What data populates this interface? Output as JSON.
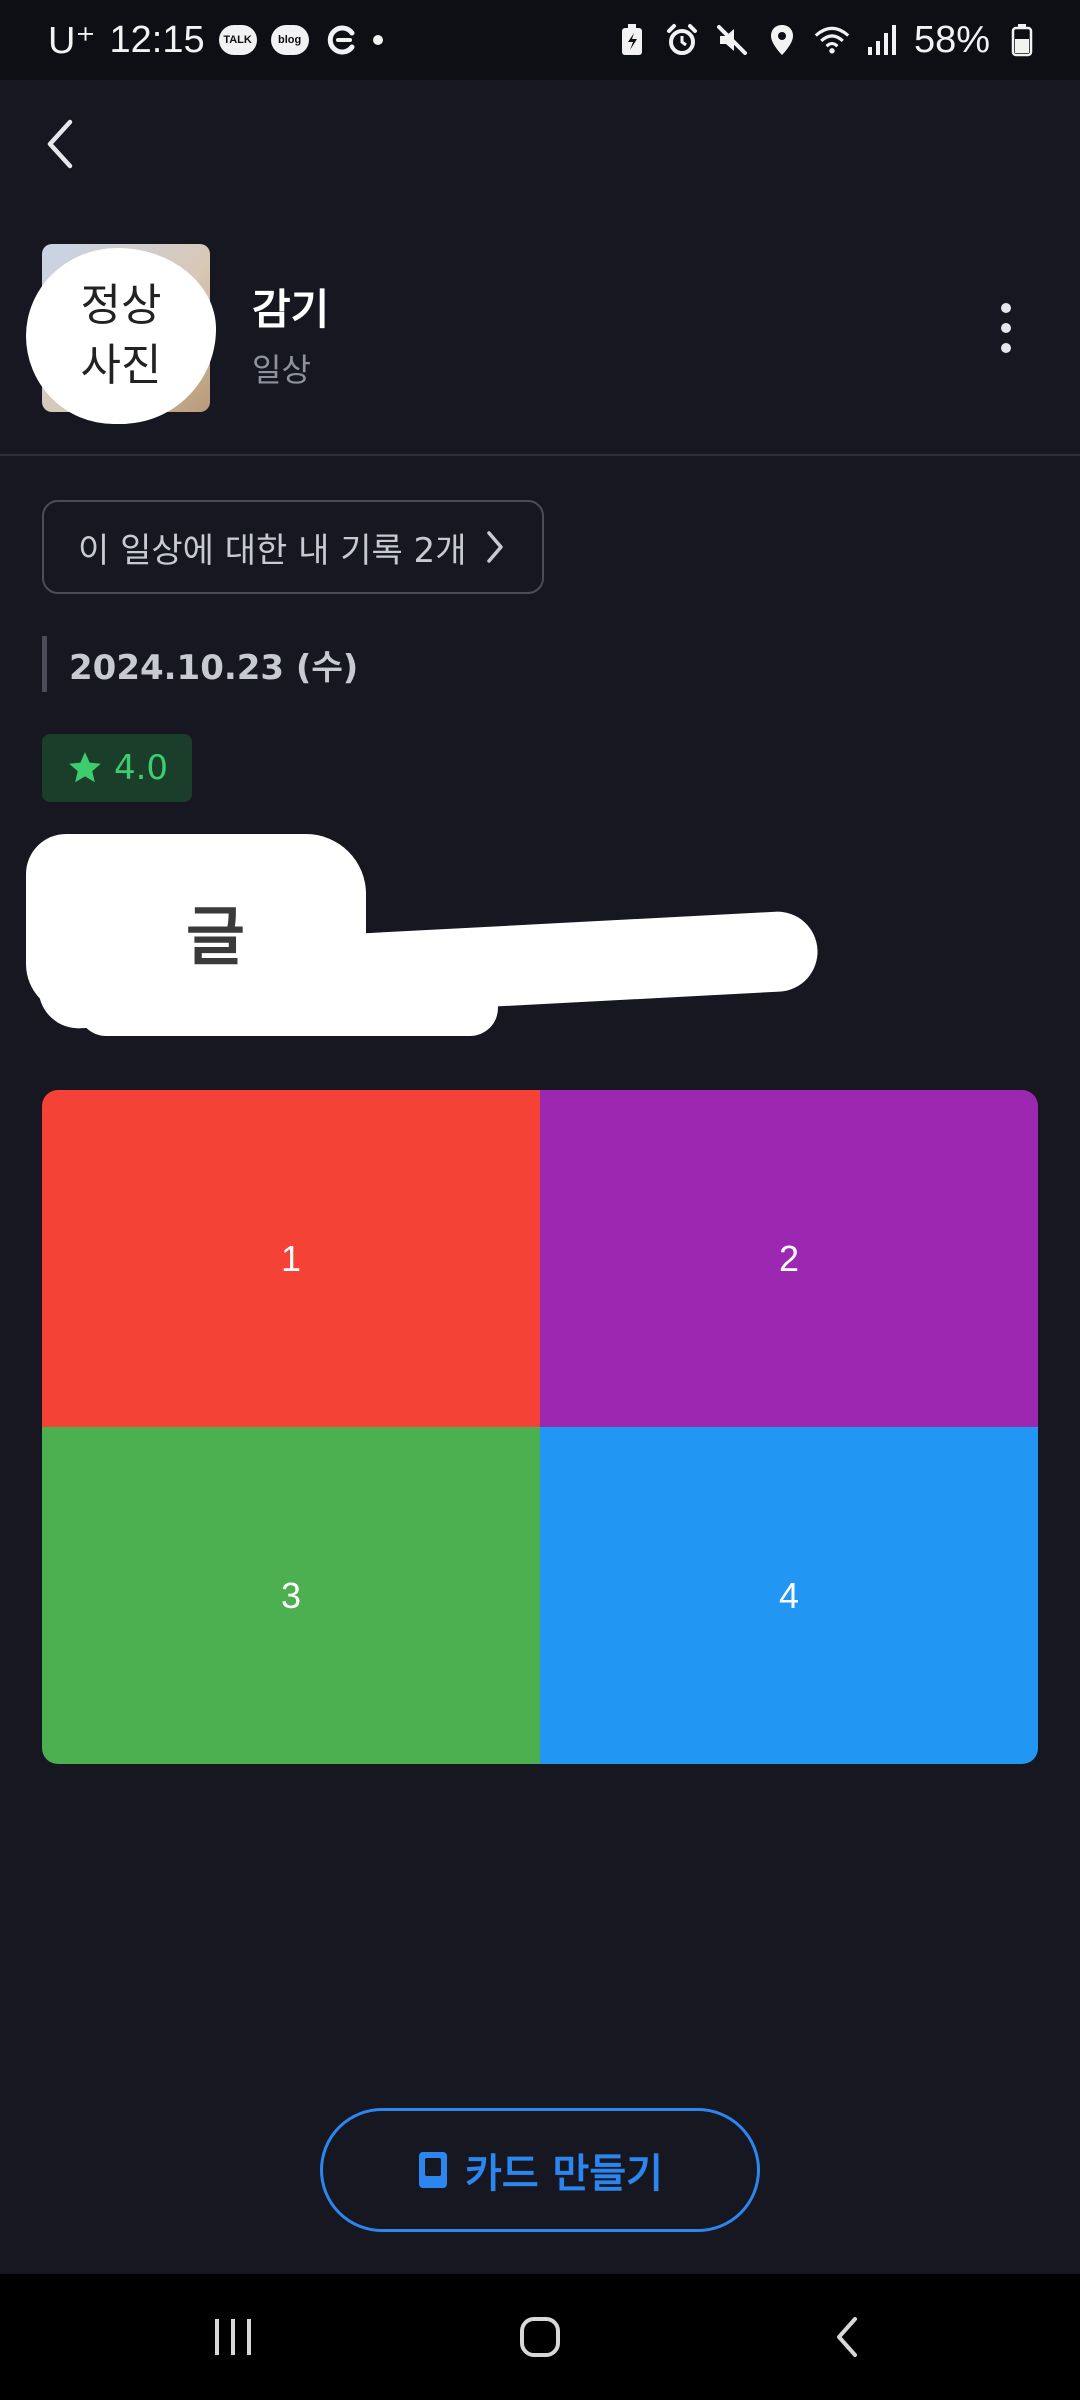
{
  "status_bar": {
    "carrier": "U⁺",
    "time": "12:15",
    "chip_talk": "TALK",
    "chip_blog": "blog",
    "battery": "58%",
    "icons": [
      "talk-icon",
      "blog-icon",
      "g-icon",
      "notification-dot",
      "battery-saver-icon",
      "alarm-icon",
      "mute-icon",
      "location-icon",
      "wifi-icon",
      "signal-icon",
      "battery-icon"
    ]
  },
  "header": {
    "back_icon": "chevron-left-icon",
    "profile_overlay_line1": "정상",
    "profile_overlay_line2": "사진",
    "title": "감기",
    "subtitle": "일상",
    "more_icon": "more-vertical-icon"
  },
  "records": {
    "label": "이 일상에 대한 내 기록 2개",
    "chevron_icon": "chevron-right-icon"
  },
  "entry": {
    "date": "2024.10.23 (수)",
    "rating": "4.0",
    "rating_icon": "star-icon",
    "text_overlay": "글"
  },
  "grid": {
    "cells": [
      {
        "label": "1",
        "color": "#f44336"
      },
      {
        "label": "2",
        "color": "#9c27b0"
      },
      {
        "label": "3",
        "color": "#4caf50"
      },
      {
        "label": "4",
        "color": "#2196f3"
      }
    ]
  },
  "actions": {
    "make_card_label": "카드 만들기",
    "make_card_icon": "card-icon",
    "accent": "#2b86f0"
  },
  "nav_bar": {
    "icons": [
      "recents-icon",
      "home-icon",
      "back-icon"
    ]
  }
}
